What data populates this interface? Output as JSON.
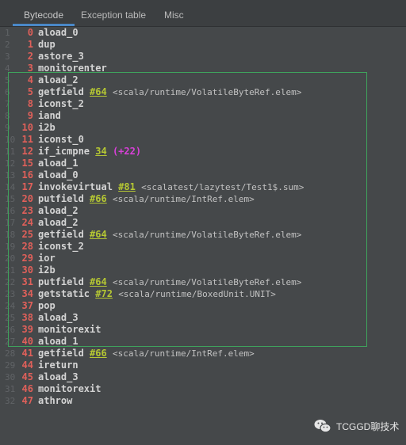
{
  "tabs": [
    {
      "label": "Bytecode",
      "active": true
    },
    {
      "label": "Exception table",
      "active": false
    },
    {
      "label": "Misc",
      "active": false
    }
  ],
  "lines": [
    {
      "n": "1",
      "off": "0",
      "instr": "aload_0"
    },
    {
      "n": "2",
      "off": "1",
      "instr": "dup"
    },
    {
      "n": "3",
      "off": "2",
      "instr": "astore_3"
    },
    {
      "n": "4",
      "off": "3",
      "instr": "monitorenter"
    },
    {
      "n": "5",
      "off": "4",
      "instr": "aload_2"
    },
    {
      "n": "6",
      "off": "5",
      "instr": "getfield",
      "ref": "#64",
      "comment": "<scala/runtime/VolatileByteRef.elem>"
    },
    {
      "n": "7",
      "off": "8",
      "instr": "iconst_2"
    },
    {
      "n": "8",
      "off": "9",
      "instr": "iand"
    },
    {
      "n": "9",
      "off": "10",
      "instr": "i2b"
    },
    {
      "n": "10",
      "off": "11",
      "instr": "iconst_0"
    },
    {
      "n": "11",
      "off": "12",
      "instr": "if_icmpne",
      "ref": "34",
      "jump": "(+22)"
    },
    {
      "n": "12",
      "off": "15",
      "instr": "aload_1"
    },
    {
      "n": "13",
      "off": "16",
      "instr": "aload_0"
    },
    {
      "n": "14",
      "off": "17",
      "instr": "invokevirtual",
      "ref": "#81",
      "comment": "<scalatest/lazytest/Test1$.sum>"
    },
    {
      "n": "15",
      "off": "20",
      "instr": "putfield",
      "ref": "#66",
      "comment": "<scala/runtime/IntRef.elem>"
    },
    {
      "n": "16",
      "off": "23",
      "instr": "aload_2"
    },
    {
      "n": "17",
      "off": "24",
      "instr": "aload_2"
    },
    {
      "n": "18",
      "off": "25",
      "instr": "getfield",
      "ref": "#64",
      "comment": "<scala/runtime/VolatileByteRef.elem>"
    },
    {
      "n": "19",
      "off": "28",
      "instr": "iconst_2"
    },
    {
      "n": "20",
      "off": "29",
      "instr": "ior"
    },
    {
      "n": "21",
      "off": "30",
      "instr": "i2b"
    },
    {
      "n": "22",
      "off": "31",
      "instr": "putfield",
      "ref": "#64",
      "comment": "<scala/runtime/VolatileByteRef.elem>"
    },
    {
      "n": "23",
      "off": "34",
      "instr": "getstatic",
      "ref": "#72",
      "comment": "<scala/runtime/BoxedUnit.UNIT>"
    },
    {
      "n": "24",
      "off": "37",
      "instr": "pop"
    },
    {
      "n": "25",
      "off": "38",
      "instr": "aload_3"
    },
    {
      "n": "26",
      "off": "39",
      "instr": "monitorexit"
    },
    {
      "n": "27",
      "off": "40",
      "instr": "aload_1"
    },
    {
      "n": "28",
      "off": "41",
      "instr": "getfield",
      "ref": "#66",
      "comment": "<scala/runtime/IntRef.elem>"
    },
    {
      "n": "29",
      "off": "44",
      "instr": "ireturn"
    },
    {
      "n": "30",
      "off": "45",
      "instr": "aload_3"
    },
    {
      "n": "31",
      "off": "46",
      "instr": "monitorexit"
    },
    {
      "n": "32",
      "off": "47",
      "instr": "athrow"
    }
  ],
  "watermark": {
    "icon": "wechat-icon",
    "text": "TCGGD聊技术"
  },
  "colors": {
    "accent": "#4a88c7",
    "offset": "#e0605a",
    "ref": "#b5c733",
    "jump": "#d940d9",
    "highlight_box": "#3fa35c"
  }
}
